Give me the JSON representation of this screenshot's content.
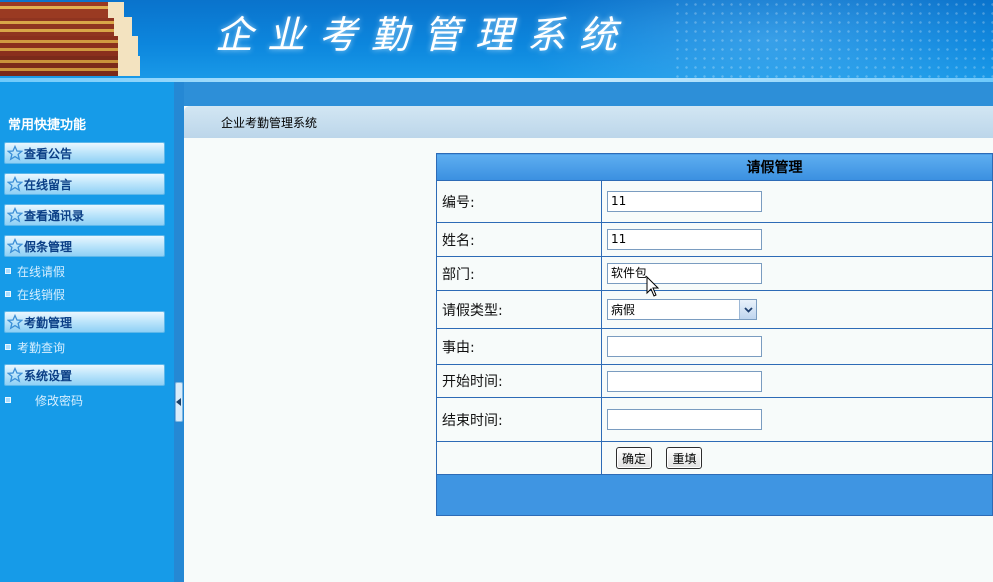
{
  "app": {
    "title": "企业考勤管理系统",
    "header_icon": "books-stack-icon"
  },
  "sidebar": {
    "title": "常用快捷功能",
    "groups": [
      {
        "label": "查看公告",
        "icon": "star-icon",
        "items": []
      },
      {
        "label": "在线留言",
        "icon": "star-icon",
        "items": []
      },
      {
        "label": "查看通讯录",
        "icon": "star-icon",
        "items": []
      },
      {
        "label": "假条管理",
        "icon": "star-icon",
        "items": [
          {
            "label": "在线请假"
          },
          {
            "label": "在线销假"
          }
        ]
      },
      {
        "label": "考勤管理",
        "icon": "star-icon",
        "items": [
          {
            "label": "考勤查询"
          }
        ]
      },
      {
        "label": "系统设置",
        "icon": "star-icon",
        "items": [
          {
            "label": "修改密码"
          }
        ]
      }
    ]
  },
  "breadcrumb": {
    "text": "企业考勤管理系统"
  },
  "form": {
    "title": "请假管理",
    "fields": {
      "id": {
        "label": "编号:",
        "value": "11"
      },
      "name": {
        "label": "姓名:",
        "value": "11"
      },
      "department": {
        "label": "部门:",
        "value": "软件包"
      },
      "leave_type": {
        "label": "请假类型:",
        "value": "病假"
      },
      "reason": {
        "label": "事由:",
        "value": ""
      },
      "start_time": {
        "label": "开始时间:",
        "value": ""
      },
      "end_time": {
        "label": "结束时间:",
        "value": ""
      }
    },
    "buttons": {
      "submit": "确定",
      "reset": "重填"
    }
  },
  "colors": {
    "header": "#0c86dd",
    "sidebar": "#169be8",
    "table_border": "#2d6bb6",
    "table_head": "#3a8fe0"
  }
}
